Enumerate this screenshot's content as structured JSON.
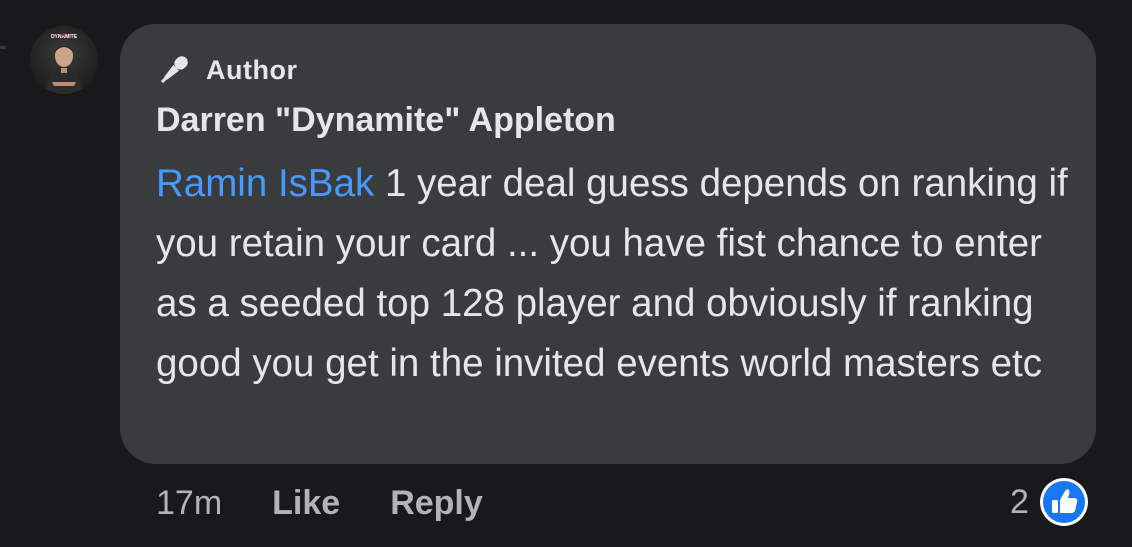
{
  "comment": {
    "badge": {
      "icon": "microphone-icon",
      "label": "Author"
    },
    "author_name": "Darren \"Dynamite\" Appleton",
    "avatar_text": "DYNAMITE",
    "mention": "Ramin IsBak",
    "text": " 1 year deal guess depends on ranking if you retain your card ... you have fist chance to enter as a seeded top 128 player and obviously if ranking good you get in the invited events world masters etc",
    "timestamp": "17m",
    "actions": {
      "like": "Like",
      "reply": "Reply"
    },
    "reactions": {
      "count": "2",
      "icon": "like-thumbs-up-icon"
    }
  },
  "colors": {
    "background": "#18191a",
    "bubble": "#3a3b3c",
    "text": "#e4e6eb",
    "muted": "#b0b3b8",
    "mention": "#4599ff",
    "like_blue": "#1877f2"
  }
}
